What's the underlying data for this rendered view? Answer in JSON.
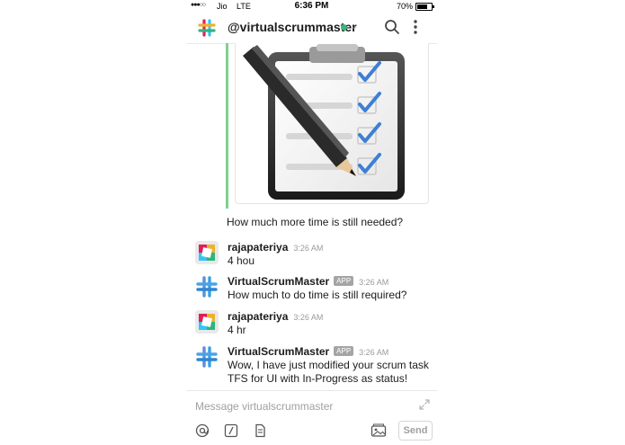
{
  "status_bar": {
    "signal": "●●●○○",
    "carrier": "Jio",
    "network": "LTE",
    "time": "6:36 PM",
    "battery_pct": "70%",
    "battery_level": 0.7
  },
  "header": {
    "channel": "@virtualscrummaster",
    "presence_color": "#3db27d"
  },
  "attachment": {
    "caption": "How much more time is still needed?",
    "accent_color": "#7fd18f"
  },
  "messages": [
    {
      "author": "rajapateriya",
      "app_badge": "",
      "time": "3:26 AM",
      "text": "4 hou",
      "avatar": "user-avatar"
    },
    {
      "author": "VirtualScrumMaster",
      "app_badge": "APP",
      "time": "3:26 AM",
      "text": "How much to do time is still required?",
      "avatar": "bot-avatar"
    },
    {
      "author": "rajapateriya",
      "app_badge": "",
      "time": "3:26 AM",
      "text": "4 hr",
      "avatar": "user-avatar"
    },
    {
      "author": "VirtualScrumMaster",
      "app_badge": "APP",
      "time": "3:26 AM",
      "text": "Wow, I have just modified your scrum task TFS for UI with In-Progress as status!",
      "avatar": "bot-avatar"
    }
  ],
  "composer": {
    "placeholder": "Message virtualscrummaster",
    "send_label": "Send",
    "tools": [
      "at-icon",
      "slash-icon",
      "file-icon",
      "image-icon"
    ]
  }
}
